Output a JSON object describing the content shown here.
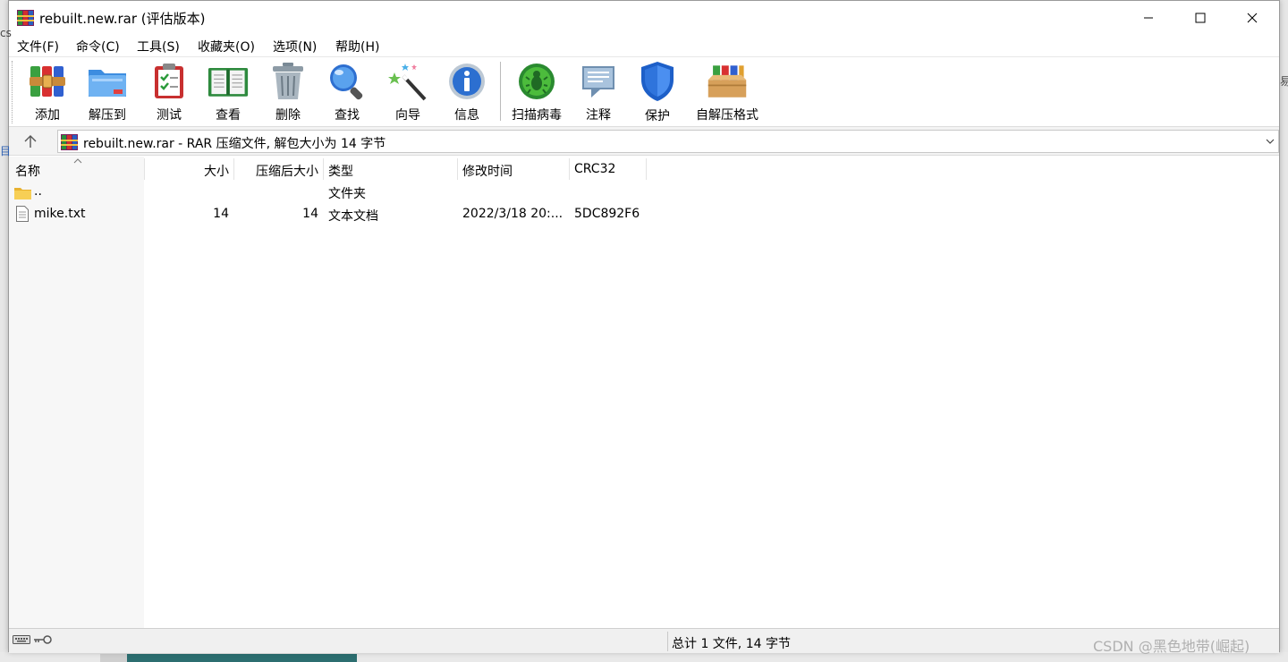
{
  "window": {
    "title": "rebuilt.new.rar (评估版本)"
  },
  "menu": [
    {
      "label": "文件(F)"
    },
    {
      "label": "命令(C)"
    },
    {
      "label": "工具(S)"
    },
    {
      "label": "收藏夹(O)"
    },
    {
      "label": "选项(N)"
    },
    {
      "label": "帮助(H)"
    }
  ],
  "toolbar": [
    {
      "label": "添加",
      "icon": "add-archive-icon"
    },
    {
      "label": "解压到",
      "icon": "extract-folder-icon"
    },
    {
      "label": "测试",
      "icon": "test-clipboard-icon"
    },
    {
      "label": "查看",
      "icon": "view-book-icon"
    },
    {
      "label": "删除",
      "icon": "trash-can-icon"
    },
    {
      "label": "查找",
      "icon": "magnifier-icon"
    },
    {
      "label": "向导",
      "icon": "magic-wand-icon"
    },
    {
      "label": "信息",
      "icon": "info-icon"
    },
    {
      "label": "扫描病毒",
      "icon": "virus-scan-icon"
    },
    {
      "label": "注释",
      "icon": "comment-bubble-icon"
    },
    {
      "label": "保护",
      "icon": "shield-icon"
    },
    {
      "label": "自解压格式",
      "icon": "sfx-box-icon"
    }
  ],
  "address": {
    "text": "rebuilt.new.rar - RAR 压缩文件, 解包大小为 14 字节"
  },
  "columns": {
    "name": "名称",
    "size": "大小",
    "packed": "压缩后大小",
    "type": "类型",
    "modified": "修改时间",
    "crc": "CRC32"
  },
  "rows": [
    {
      "name": "..",
      "size": "",
      "packed": "",
      "type": "文件夹",
      "modified": "",
      "crc": "",
      "icon": "folder-icon"
    },
    {
      "name": "mike.txt",
      "size": "14",
      "packed": "14",
      "type": "文本文档",
      "modified": "2022/3/18 20:...",
      "crc": "5DC892F6",
      "icon": "text-file-icon"
    }
  ],
  "status": {
    "text": "总计 1 文件, 14 字节"
  },
  "watermark": "CSDN @黑色地带(崛起)",
  "colors": {
    "window_bg": "#ffffff",
    "list_name_col_bg": "#f7f7f7",
    "status_bg": "#f0f0f0"
  }
}
